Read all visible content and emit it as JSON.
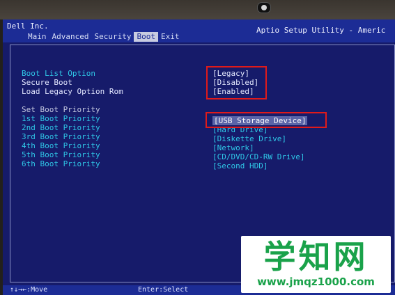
{
  "header": {
    "vendor": "Dell Inc.",
    "utility_title": "Aptio Setup Utility - Americ",
    "tabs": [
      {
        "label": "Main",
        "active": false
      },
      {
        "label": "Advanced",
        "active": false
      },
      {
        "label": "Security",
        "active": false
      },
      {
        "label": "Boot",
        "active": true
      },
      {
        "label": "Exit",
        "active": false
      }
    ]
  },
  "settings": [
    {
      "label": "Boot List Option",
      "value": "[Legacy]"
    },
    {
      "label": "Secure Boot",
      "value": "[Disabled]"
    },
    {
      "label": "Load Legacy Option Rom",
      "value": "[Enabled]"
    }
  ],
  "priority": {
    "heading": "Set Boot Priority",
    "items": [
      {
        "label": "1st Boot Priority",
        "value": "[USB Storage Device]",
        "selected": true
      },
      {
        "label": "2nd Boot Priority",
        "value": "[Hard Drive]"
      },
      {
        "label": "3rd Boot Priority",
        "value": "[Diskette Drive]"
      },
      {
        "label": "4th Boot Priority",
        "value": "[Network]"
      },
      {
        "label": "5th Boot Priority",
        "value": "[CD/DVD/CD-RW Drive]"
      },
      {
        "label": "6th Boot Priority",
        "value": "[Second HDD]"
      }
    ]
  },
  "footer": {
    "move": "↑↓→←:Move",
    "select": "Enter:Select"
  },
  "watermark": {
    "title": "学知网",
    "url": "www.jmqz1000.com"
  },
  "colors": {
    "background": "#161b6a",
    "header": "#1c2c95",
    "cyan_text": "#2fc6e6",
    "highlight_box": "#e01a1a",
    "watermark_green": "#1aa24a"
  }
}
